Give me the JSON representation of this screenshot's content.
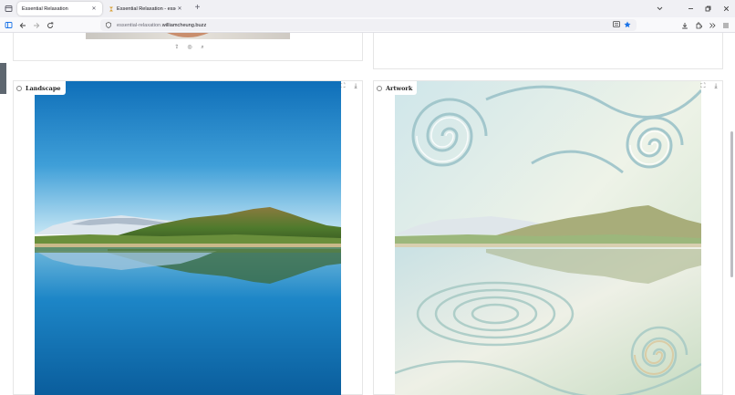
{
  "browser": {
    "tabs": [
      {
        "title": "Essential Relaxation",
        "active": true
      },
      {
        "title": "Essential Relaxation - essential -",
        "active": false
      }
    ],
    "url_prefix": "essential-relaxation.",
    "url_host": "williamcheung.buzz"
  },
  "cards": {
    "landscape": {
      "label": "Landscape"
    },
    "artwork": {
      "label": "Artwork"
    }
  },
  "colors": {
    "sky_top": "#0f74c2",
    "sky_horizon": "#bfe3f4",
    "water": "#0c74b6",
    "accent_star": "#1a73e8"
  }
}
